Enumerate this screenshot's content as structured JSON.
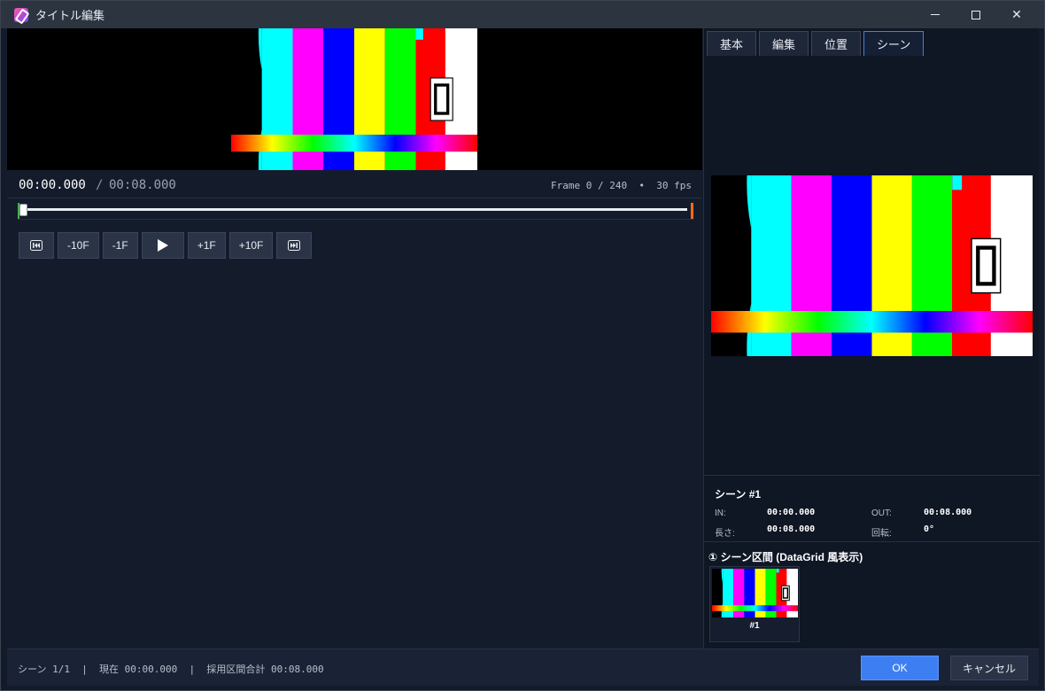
{
  "window": {
    "title": "タイトル編集"
  },
  "preview": {
    "bar_colors": [
      "#00ffff",
      "#ff00ff",
      "#0000ff",
      "#ffff00",
      "#00ff00",
      "#ff0000",
      "#ffffff"
    ],
    "digit": "0"
  },
  "playback": {
    "current_time": "00:00.000",
    "separator": "/",
    "total_time": "00:08.000",
    "frame_info": "Frame 0 / 240  •  30 fps",
    "progress": 0
  },
  "transport": {
    "first_icon": "skip-to-start-icon",
    "minus10_label": "-10F",
    "minus1_label": "-1F",
    "play_icon": "play-icon",
    "plus1_label": "+1F",
    "plus10_label": "+10F",
    "last_icon": "skip-to-end-icon"
  },
  "tabs": [
    {
      "label": "基本"
    },
    {
      "label": "編集"
    },
    {
      "label": "位置"
    },
    {
      "label": "シーン"
    }
  ],
  "active_tab": "シーン",
  "scene": {
    "title": "シーン #1",
    "in_label": "IN:",
    "in_value": "00:00.000",
    "out_label": "OUT:",
    "out_value": "00:08.000",
    "length_label": "長さ:",
    "length_value": "00:08.000",
    "rotation_label": "回転:",
    "rotation_value": "0°"
  },
  "scene_list": {
    "title": "① シーン区間 (DataGrid 風表示)",
    "items": [
      {
        "label": "#1"
      }
    ]
  },
  "footer": {
    "status": "シーン 1/1  |  現在 00:00.000  |  採用区間合計 00:08.000",
    "ok_label": "OK",
    "cancel_label": "キャンセル"
  },
  "colors": {
    "accent": "#3d7ff2",
    "in_marker": "#4caf50",
    "out_marker": "#ff6a1a"
  }
}
